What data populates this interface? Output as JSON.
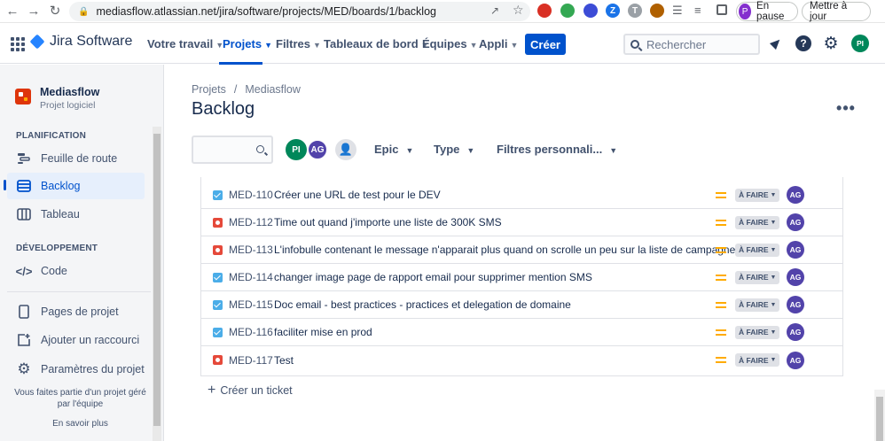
{
  "browser": {
    "url": "mediasflow.atlassian.net/jira/software/projects/MED/boards/1/backlog",
    "profile_initial": "P",
    "pause_label": "En pause",
    "update_label": "Mettre à jour"
  },
  "topnav": {
    "product": "Jira Software",
    "items": [
      {
        "label": "Votre travail"
      },
      {
        "label": "Projets"
      },
      {
        "label": "Filtres"
      },
      {
        "label": "Tableaux de bord"
      },
      {
        "label": "Équipes"
      },
      {
        "label": "Appli"
      }
    ],
    "create_label": "Créer",
    "search_placeholder": "Rechercher",
    "user_initials": "PI"
  },
  "sidebar": {
    "project_name": "Mediasflow",
    "project_type": "Projet logiciel",
    "planning_title": "PLANIFICATION",
    "planning_items": [
      {
        "label": "Feuille de route",
        "icon": "roadmap-icon"
      },
      {
        "label": "Backlog",
        "icon": "backlog-icon"
      },
      {
        "label": "Tableau",
        "icon": "board-icon"
      }
    ],
    "dev_title": "DÉVELOPPEMENT",
    "dev_items": [
      {
        "label": "Code",
        "icon": "code-icon"
      }
    ],
    "other_items": [
      {
        "label": "Pages de projet",
        "icon": "page-icon"
      },
      {
        "label": "Ajouter un raccourci",
        "icon": "add-shortcut-icon"
      },
      {
        "label": "Paramètres du projet",
        "icon": "gear-icon"
      }
    ],
    "footer_text": "Vous faites partie d'un projet géré par l'équipe",
    "footer_link": "En savoir plus"
  },
  "main": {
    "breadcrumb": [
      "Projets",
      "Mediasflow"
    ],
    "title": "Backlog",
    "avatars": [
      {
        "initials": "PI",
        "color": "#00875a"
      },
      {
        "initials": "AG",
        "color": "#5243aa"
      }
    ],
    "filters": [
      {
        "label": "Epic"
      },
      {
        "label": "Type"
      },
      {
        "label": "Filtres personnali..."
      }
    ],
    "issues": [
      {
        "type": "task",
        "key": "MED-110",
        "summary": "Créer une URL de test pour le DEV",
        "status": "À FAIRE",
        "assignee": "AG"
      },
      {
        "type": "bug",
        "key": "MED-112",
        "summary": "Time out quand j'importe une liste de 300K SMS",
        "status": "À FAIRE",
        "assignee": "AG"
      },
      {
        "type": "bug",
        "key": "MED-113",
        "summary": "L'infobulle contenant le message n'apparait plus quand on scrolle un peu sur la liste de campagne",
        "status": "À FAIRE",
        "assignee": "AG"
      },
      {
        "type": "task",
        "key": "MED-114",
        "summary": "changer image page de rapport email pour supprimer mention SMS",
        "status": "À FAIRE",
        "assignee": "AG"
      },
      {
        "type": "task",
        "key": "MED-115",
        "summary": "Doc email - best practices - practices et delegation de domaine",
        "status": "À FAIRE",
        "assignee": "AG"
      },
      {
        "type": "task",
        "key": "MED-116",
        "summary": "faciliter mise en prod",
        "status": "À FAIRE",
        "assignee": "AG"
      },
      {
        "type": "bug",
        "key": "MED-117",
        "summary": "Test",
        "status": "À FAIRE",
        "assignee": "AG"
      }
    ],
    "create_ticket_label": "Créer un ticket"
  }
}
